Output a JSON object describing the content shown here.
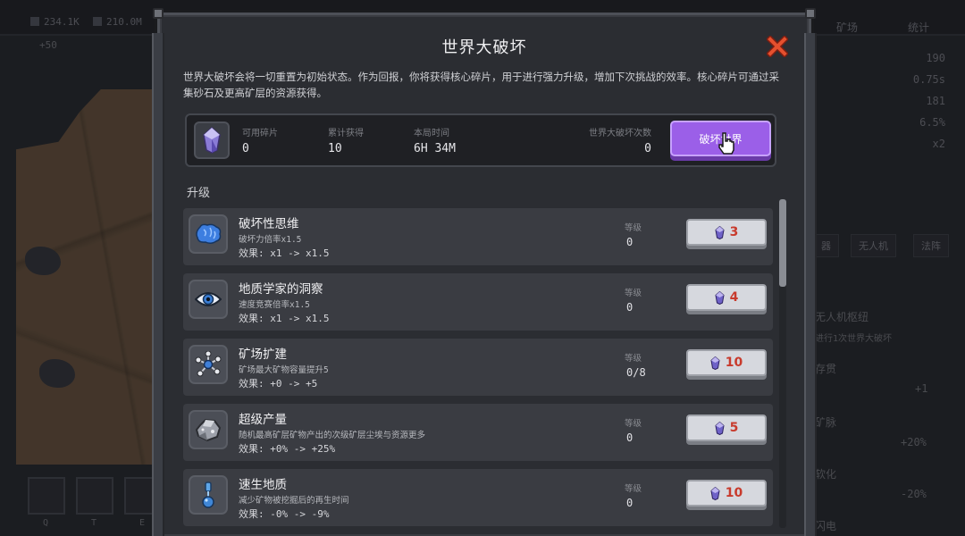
{
  "background": {
    "resources": [
      "234.1K",
      "210.0M"
    ],
    "gain": "+50",
    "right_headers": [
      "矿场",
      "统计"
    ],
    "stats": [
      "190",
      "0.75s",
      "181",
      "6.5%",
      "x2"
    ],
    "tabs": [
      "器",
      "无人机",
      "法阵"
    ],
    "items": [
      {
        "title": "无人机枢纽",
        "sub": "进行1次世界大破坏",
        "value": ""
      },
      {
        "title": "存贯",
        "sub": "",
        "value": "+1"
      },
      {
        "title": "矿脉",
        "sub": "",
        "value": "+20%"
      },
      {
        "title": "软化",
        "sub": "",
        "value": "-20%"
      },
      {
        "title": "闪电",
        "sub": "",
        "value": ""
      }
    ],
    "hotkeys": [
      "Q",
      "T",
      "E"
    ]
  },
  "modal": {
    "title": "世界大破坏",
    "description": "世界大破坏会将一切重置为初始状态。作为回报，你将获得核心碎片，用于进行强力升级，增加下次挑战的效率。核心碎片可通过采集砂石及更高矿层的资源获得。",
    "info": {
      "current_shards_label": "可用碎片",
      "current_shards": "0",
      "total_earned_label": "累计获得",
      "total_earned": "10",
      "run_time_label": "本局时间",
      "run_time": "6H 34M",
      "destroy_count_label": "世界大破坏次数",
      "destroy_count": "0",
      "destroy_button": "破坏世界"
    },
    "section_title": "升级",
    "level_label": "等级",
    "upgrades": [
      {
        "name": "破坏性思维",
        "desc": "破坏力倍率x1.5",
        "effect": "效果: x1 -> x1.5",
        "level": "0",
        "cost": "3",
        "cost_color": "#c83a2c",
        "icon": "brain-icon"
      },
      {
        "name": "地质学家的洞察",
        "desc": "速度竞赛倍率x1.5",
        "effect": "效果: x1 -> x1.5",
        "level": "0",
        "cost": "4",
        "cost_color": "#c83a2c",
        "icon": "eye-icon"
      },
      {
        "name": "矿场扩建",
        "desc": "矿场最大矿物容量提升5",
        "effect": "效果: +0 -> +5",
        "level": "0/8",
        "cost": "10",
        "cost_color": "#c83a2c",
        "icon": "nodes-icon"
      },
      {
        "name": "超级产量",
        "desc": "随机最高矿层矿物产出的次级矿层尘埃与资源更多",
        "effect": "效果: +0% -> +25%",
        "level": "0",
        "cost": "5",
        "cost_color": "#c83a2c",
        "icon": "ore-icon"
      },
      {
        "name": "速生地质",
        "desc": "减少矿物被挖掘后的再生时间",
        "effect": "效果: -0% -> -9%",
        "level": "0",
        "cost": "10",
        "cost_color": "#c83a2c",
        "icon": "hourglass-icon"
      }
    ]
  }
}
